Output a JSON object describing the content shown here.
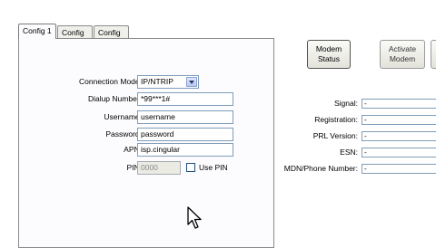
{
  "tabs": [
    {
      "label": "Config 1",
      "active": true
    },
    {
      "label": "Config 2",
      "active": false
    },
    {
      "label": "Config 3",
      "active": false
    }
  ],
  "config": {
    "connection_mode": {
      "label": "Connection Mode:",
      "value": "IP/NTRIP"
    },
    "dialup_number": {
      "label": "Dialup Number:",
      "value": "*99***1#"
    },
    "username": {
      "label": "Username:",
      "value": "username"
    },
    "password": {
      "label": "Password:",
      "value": "password"
    },
    "apn": {
      "label": "APN:",
      "value": "isp.cingular"
    },
    "pin": {
      "label": "PIN:",
      "value": "0000",
      "use_pin_label": "Use PIN",
      "use_pin_checked": false
    }
  },
  "buttons": {
    "modem_status": "Modem Status",
    "activate_modem": "Activate Modem"
  },
  "status": [
    {
      "label": "Signal:",
      "value": "-"
    },
    {
      "label": "Registration:",
      "value": "-"
    },
    {
      "label": "PRL Version:",
      "value": "-"
    },
    {
      "label": "ESN:",
      "value": "-"
    },
    {
      "label": "MDN/Phone Number:",
      "value": "-"
    }
  ],
  "icons": {
    "cursor": "mouse-pointer-icon",
    "dropdown": "chevron-down-icon"
  }
}
